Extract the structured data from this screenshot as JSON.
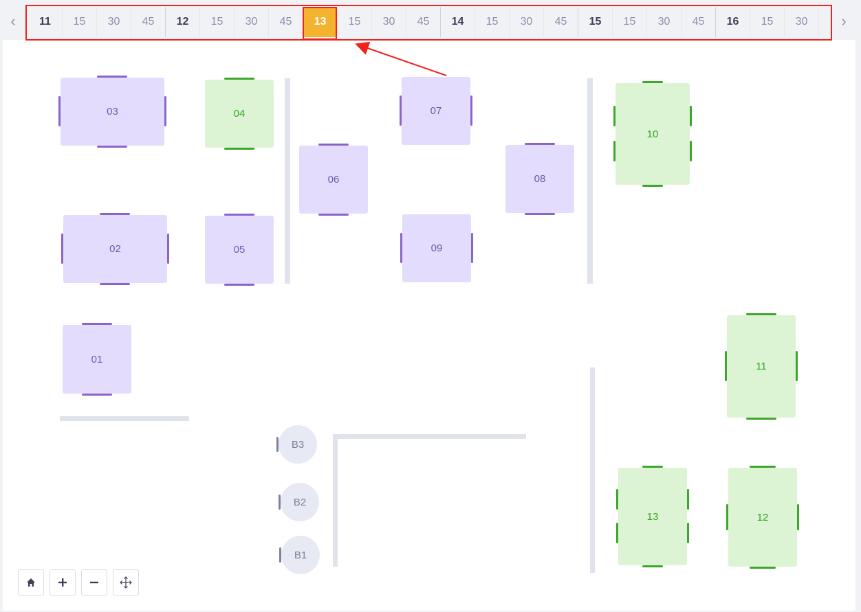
{
  "timeline": {
    "prev_icon": "chevron-left-icon",
    "next_icon": "chevron-right-icon",
    "cells": [
      {
        "label": "11",
        "kind": "hour"
      },
      {
        "label": "15",
        "kind": "quarter"
      },
      {
        "label": "30",
        "kind": "quarter"
      },
      {
        "label": "45",
        "kind": "quarter"
      },
      {
        "label": "12",
        "kind": "hour"
      },
      {
        "label": "15",
        "kind": "quarter"
      },
      {
        "label": "30",
        "kind": "quarter"
      },
      {
        "label": "45",
        "kind": "quarter"
      },
      {
        "label": "13",
        "kind": "hour",
        "active": true
      },
      {
        "label": "15",
        "kind": "quarter"
      },
      {
        "label": "30",
        "kind": "quarter"
      },
      {
        "label": "45",
        "kind": "quarter"
      },
      {
        "label": "14",
        "kind": "hour"
      },
      {
        "label": "15",
        "kind": "quarter"
      },
      {
        "label": "30",
        "kind": "quarter"
      },
      {
        "label": "45",
        "kind": "quarter"
      },
      {
        "label": "15",
        "kind": "hour"
      },
      {
        "label": "15",
        "kind": "quarter"
      },
      {
        "label": "30",
        "kind": "quarter"
      },
      {
        "label": "45",
        "kind": "quarter"
      },
      {
        "label": "16",
        "kind": "hour"
      },
      {
        "label": "15",
        "kind": "quarter"
      },
      {
        "label": "30",
        "kind": "quarter"
      }
    ],
    "active_color": "#f4b32e"
  },
  "tables": {
    "t01": {
      "label": "01",
      "status": "purple"
    },
    "t02": {
      "label": "02",
      "status": "purple"
    },
    "t03": {
      "label": "03",
      "status": "purple"
    },
    "t04": {
      "label": "04",
      "status": "green"
    },
    "t05": {
      "label": "05",
      "status": "purple"
    },
    "t06": {
      "label": "06",
      "status": "purple"
    },
    "t07": {
      "label": "07",
      "status": "purple"
    },
    "t08": {
      "label": "08",
      "status": "purple"
    },
    "t09": {
      "label": "09",
      "status": "purple"
    },
    "t10": {
      "label": "10",
      "status": "green"
    },
    "t11": {
      "label": "11",
      "status": "green"
    },
    "t12": {
      "label": "12",
      "status": "green"
    },
    "t13": {
      "label": "13",
      "status": "green"
    },
    "b1": {
      "label": "B1"
    },
    "b2": {
      "label": "B2"
    },
    "b3": {
      "label": "B3"
    }
  },
  "colors": {
    "available_table": "#e4dcfd",
    "occupied_table": "#dcf4d4",
    "highlight": "#f1221c"
  },
  "controls": {
    "home_icon": "home-icon",
    "zoom_in_icon": "plus-icon",
    "zoom_out_icon": "minus-icon",
    "pan_icon": "move-icon"
  }
}
